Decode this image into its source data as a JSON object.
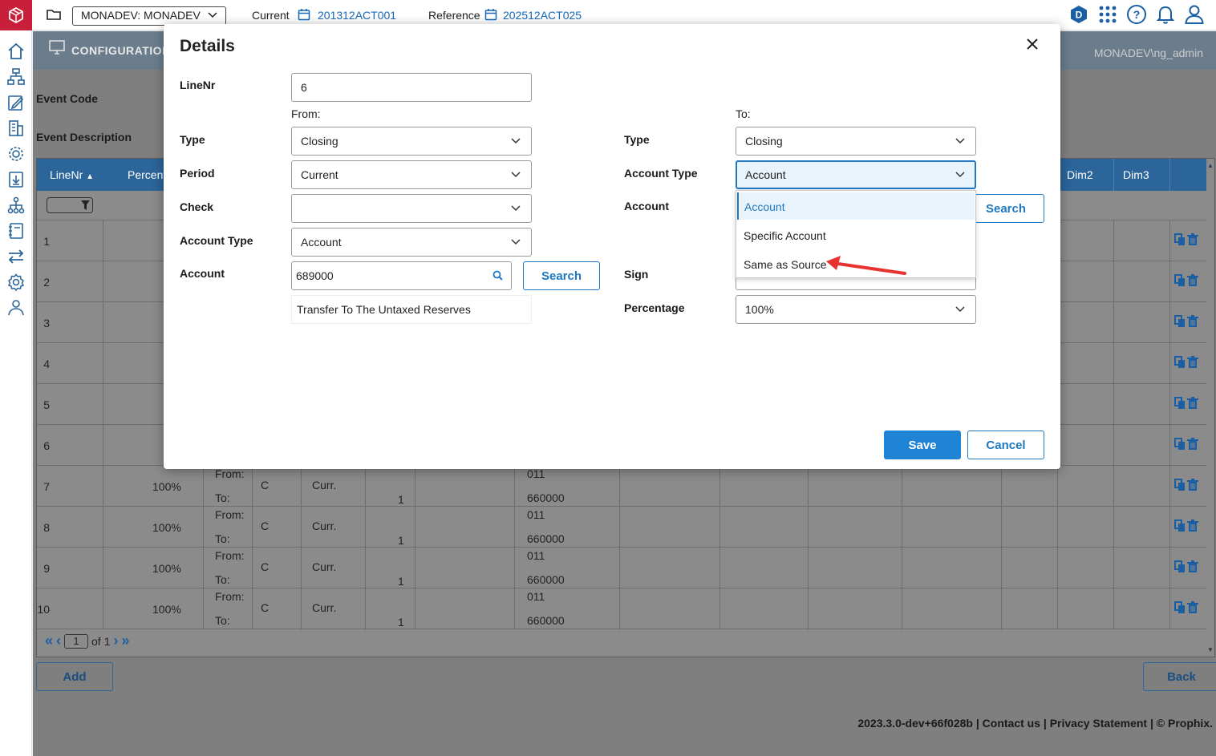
{
  "topbar": {
    "environment": "MONADEV: MONADEV",
    "current_label": "Current",
    "current_value": "201312ACT001",
    "reference_label": "Reference",
    "reference_value": "202512ACT025",
    "icons": [
      "d-badge-icon",
      "apps-grid-icon",
      "help-icon",
      "bell-icon",
      "user-icon"
    ]
  },
  "sidebar": {
    "icons": [
      "home-icon",
      "hierarchy-icon",
      "edit-report-icon",
      "building-icon",
      "settings-gear-icon",
      "download-icon",
      "org-tree-icon",
      "notebook-icon",
      "transfer-icon",
      "cog-icon",
      "users-icon"
    ]
  },
  "config": {
    "title": "CONFIGURATION",
    "user": "MONADEV\\ng_admin",
    "event_code_label": "Event Code",
    "event_description_label": "Event Description"
  },
  "grid": {
    "columns": [
      "LineNr",
      "Percent",
      "Dim2",
      "Dim3"
    ],
    "rows": [
      {
        "nr": "1"
      },
      {
        "nr": "2"
      },
      {
        "nr": "3"
      },
      {
        "nr": "4"
      },
      {
        "nr": "5"
      },
      {
        "nr": "6"
      },
      {
        "nr": "7",
        "pct": "100%",
        "from": "From:",
        "to": "To:",
        "sign": "C",
        "period": "Curr.",
        "check": "1",
        "acc_from": "011",
        "acc_to": "660000"
      },
      {
        "nr": "8",
        "pct": "100%",
        "from": "From:",
        "to": "To:",
        "sign": "C",
        "period": "Curr.",
        "check": "1",
        "acc_from": "011",
        "acc_to": "660000"
      },
      {
        "nr": "9",
        "pct": "100%",
        "from": "From:",
        "to": "To:",
        "sign": "C",
        "period": "Curr.",
        "check": "1",
        "acc_from": "011",
        "acc_to": "660000"
      },
      {
        "nr": "10",
        "pct": "100%",
        "from": "From:",
        "to": "To:",
        "sign": "C",
        "period": "Curr.",
        "check": "1",
        "acc_from": "011",
        "acc_to": "660000"
      }
    ],
    "pager": {
      "page": "1",
      "of_label": "of",
      "total": "1"
    }
  },
  "bottom": {
    "add_label": "Add",
    "back_label": "Back",
    "footer": "2023.3.0-dev+66f028b | Contact us | Privacy Statement | © Prophix."
  },
  "modal": {
    "title": "Details",
    "linenr_label": "LineNr",
    "linenr_value": "6",
    "from_label": "From:",
    "to_label": "To:",
    "from": {
      "type_label": "Type",
      "type_value": "Closing",
      "period_label": "Period",
      "period_value": "Current",
      "check_label": "Check",
      "check_value": "",
      "account_type_label": "Account Type",
      "account_type_value": "Account",
      "account_label": "Account",
      "account_value": "689000",
      "search_label": "Search",
      "account_description": "Transfer To The Untaxed Reserves"
    },
    "to": {
      "type_label": "Type",
      "type_value": "Closing",
      "account_type_label": "Account Type",
      "account_type_value": "Account",
      "account_label": "Account",
      "search_label": "Search",
      "sign_label": "Sign",
      "percentage_label": "Percentage",
      "percentage_value": "100%"
    },
    "account_type_options": [
      "Account",
      "Specific Account",
      "Same as Source"
    ],
    "save_label": "Save",
    "cancel_label": "Cancel"
  },
  "colors": {
    "brand": "#c8203a",
    "accent": "#1f78c1",
    "grid_header": "#2b6599",
    "annotation_arrow": "#e8322f"
  }
}
